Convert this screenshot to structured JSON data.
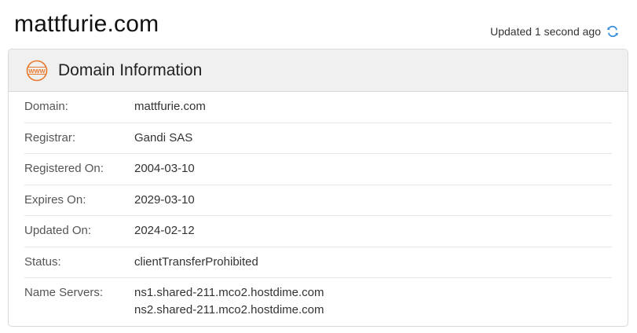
{
  "header": {
    "domain": "mattfurie.com",
    "updated_text": "Updated 1 second ago",
    "refresh_icon": "refresh-icon"
  },
  "card": {
    "icon": "www-icon",
    "icon_text": "WWW",
    "title": "Domain Information",
    "rows": [
      {
        "label": "Domain:",
        "value": "mattfurie.com"
      },
      {
        "label": "Registrar:",
        "value": "Gandi SAS"
      },
      {
        "label": "Registered On:",
        "value": "2004-03-10"
      },
      {
        "label": "Expires On:",
        "value": "2029-03-10"
      },
      {
        "label": "Updated On:",
        "value": "2024-02-12"
      },
      {
        "label": "Status:",
        "value": "clientTransferProhibited"
      }
    ],
    "name_servers": {
      "label": "Name Servers:",
      "values": [
        "ns1.shared-211.mco2.hostdime.com",
        "ns2.shared-211.mco2.hostdime.com"
      ]
    }
  },
  "colors": {
    "accent": "#e8782b",
    "refresh": "#3a8fd9"
  }
}
